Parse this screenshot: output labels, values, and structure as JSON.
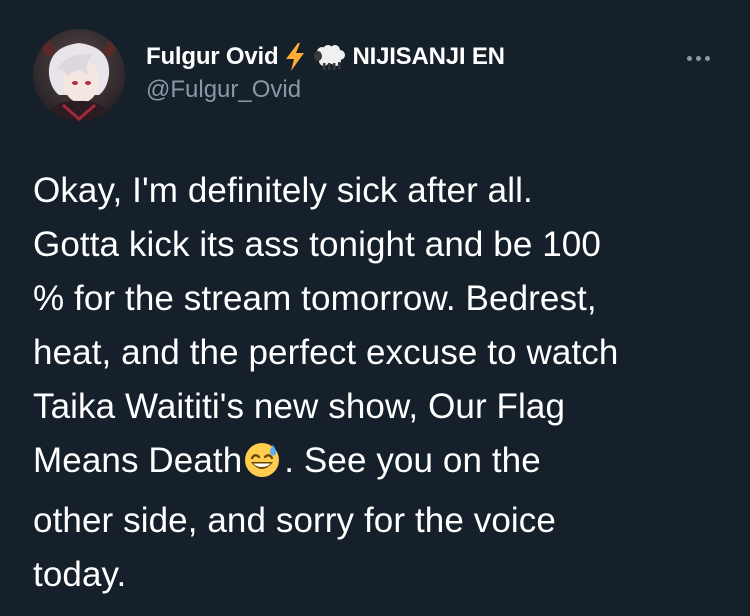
{
  "author": {
    "display_name": "Fulgur Ovid",
    "name_emojis": [
      "lightning-icon",
      "sheep-icon"
    ],
    "affiliation": "NIJISANJI EN",
    "handle": "@Fulgur_Ovid"
  },
  "tweet": {
    "lines": [
      "Okay, I'm definitely sick after all.",
      "Gotta kick its ass tonight and be 100",
      "% for the stream tomorrow. Bedrest,",
      "heat, and the perfect excuse to watch",
      "Taika Waititi's new show, Our Flag",
      "Means Death",
      ". See you on the",
      "other side, and sorry for the voice",
      "today."
    ],
    "inline_emoji": "grinning-sweat-emoji"
  },
  "colors": {
    "background": "#15202b",
    "text_primary": "#ffffff",
    "text_secondary": "#8899a6",
    "lightning": "#ffac33"
  }
}
